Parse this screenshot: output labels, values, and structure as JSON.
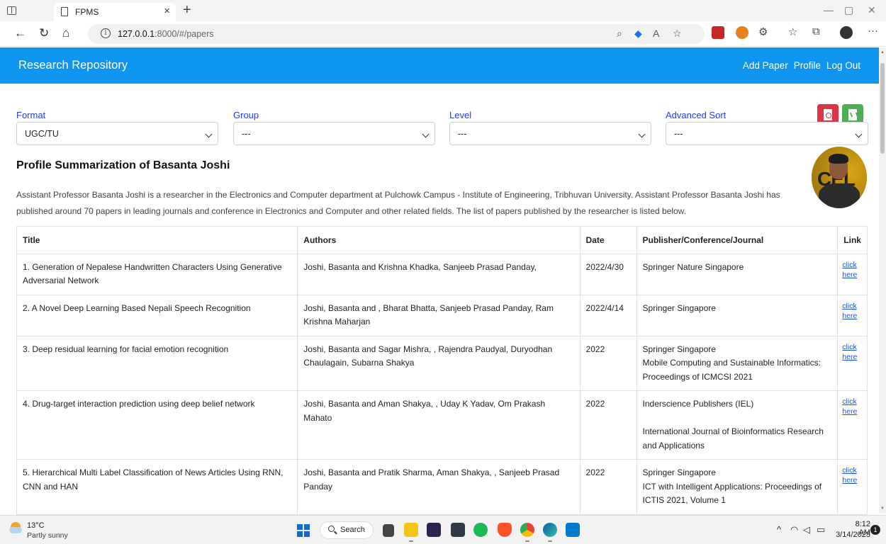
{
  "browser": {
    "tab_title": "FPMS",
    "tab_close": "×",
    "new_tab": "+",
    "url_host": "127.0.0.1",
    "url_path": ":8000/#/papers"
  },
  "app": {
    "brand": "Research Repository",
    "nav": {
      "add_paper": "Add Paper",
      "profile": "Profile",
      "logout": "Log Out"
    },
    "accent_color": "#0d95f0"
  },
  "filters": {
    "format": {
      "label": "Format",
      "value": "UGC/TU"
    },
    "group": {
      "label": "Group",
      "value": "---"
    },
    "level": {
      "label": "Level",
      "value": "---"
    },
    "advanced_sort": {
      "label": "Advanced Sort",
      "value": "---"
    }
  },
  "profile": {
    "title": "Profile Summarization of Basanta Joshi",
    "description": "Assistant Professor Basanta Joshi is a researcher in the Electronics and Computer department at Pulchowk Campus - Institute of Engineering, Tribhuvan University. Assistant Professor Basanta Joshi has published around 70 papers in leading journals and conference in Electronics and Computer and other related fields. The list of papers published by the researcher is listed below.",
    "avatar_text": "CEL"
  },
  "table": {
    "headers": {
      "title": "Title",
      "authors": "Authors",
      "date": "Date",
      "publisher": "Publisher/Conference/Journal",
      "link": "Link"
    },
    "link_line1": "click",
    "link_line2": "here",
    "rows": [
      {
        "title": "1. Generation of Nepalese Handwritten Characters Using Generative Adversarial Network",
        "authors": "Joshi, Basanta and Krishna Khadka, Sanjeeb Prasad Panday,",
        "date": "2022/4/30",
        "publisher": "Springer Nature Singapore",
        "publisher_extra": ""
      },
      {
        "title": "2. A Novel Deep Learning Based Nepali Speech Recognition",
        "authors": "Joshi, Basanta and , Bharat Bhatta, Sanjeeb Prasad Panday, Ram Krishna Maharjan",
        "date": "2022/4/14",
        "publisher": "Springer Singapore",
        "publisher_extra": ""
      },
      {
        "title": "3. Deep residual learning for facial emotion recognition",
        "authors": "Joshi, Basanta and Sagar Mishra, , Rajendra Paudyal, Duryodhan Chaulagain, Subarna Shakya",
        "date": "2022",
        "publisher": "Springer Singapore",
        "publisher_extra": "Mobile Computing and Sustainable Informatics: Proceedings of ICMCSI 2021"
      },
      {
        "title": "4. Drug-target interaction prediction using deep belief network",
        "authors": "Joshi, Basanta and Aman Shakya, , Uday K Yadav, Om Prakash Mahato",
        "date": "2022",
        "publisher": "Inderscience Publishers (IEL)",
        "publisher_extra": "International Journal of Bioinformatics Research and Applications"
      },
      {
        "title": "5. Hierarchical Multi Label Classification of News Articles Using RNN, CNN and HAN",
        "authors": "Joshi, Basanta and Pratik Sharma, Aman Shakya, , Sanjeeb Prasad Panday",
        "date": "2022",
        "publisher": "Springer Singapore",
        "publisher_extra": "ICT with Intelligent Applications: Proceedings of ICTIS 2021, Volume 1"
      }
    ]
  },
  "taskbar": {
    "weather_temp": "13°C",
    "weather_desc": "Partly sunny",
    "search_label": "Search",
    "time": "8:12 AM",
    "date": "3/14/2023",
    "notification_count": "1"
  }
}
